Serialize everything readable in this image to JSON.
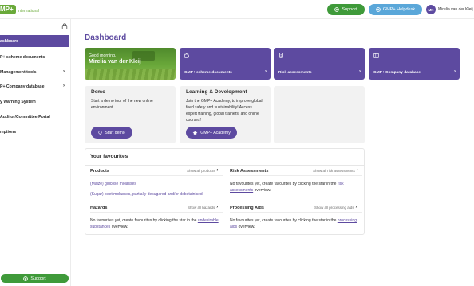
{
  "header": {
    "logo_badge": "MP+",
    "logo_text": "International",
    "support_label": "Support",
    "helpdesk_label": "GMP+ Helpdesk",
    "user_initials": "MK",
    "user_name": "Mirelia van der Kleij"
  },
  "sidebar": {
    "items": [
      {
        "label": "ashboard",
        "active": true,
        "chevron": ""
      },
      {
        "label": "P+ scheme documents",
        "active": false,
        "chevron": ""
      },
      {
        "label": "Management tools",
        "active": false,
        "chevron": "›"
      },
      {
        "label": "P+ Company database",
        "active": false,
        "chevron": "›"
      },
      {
        "label": "y Warning System",
        "active": false,
        "chevron": ""
      },
      {
        "label": "Auditor/Committee Portal",
        "active": false,
        "chevron": ""
      },
      {
        "label": "mptions",
        "active": false,
        "chevron": ""
      }
    ],
    "support_label": "Support"
  },
  "main": {
    "title": "Dashboard",
    "welcome": {
      "greeting": "Good morning,",
      "name": "Mirelia van der Kleij"
    },
    "tiles": [
      {
        "label": "GMP+ scheme documents",
        "icon": "puzzle-icon"
      },
      {
        "label": "Risk assessments",
        "icon": "document-icon"
      },
      {
        "label": "GMP+ Company database",
        "icon": "building-icon"
      }
    ],
    "demo": {
      "title": "Demo",
      "text": "Start a demo tour of the new online environment.",
      "button": "Start demo"
    },
    "learning": {
      "title": "Learning & Development",
      "text": "Join the GMP+ Academy, to improve global feed safety and sustainability! Access expert training, global trainers, and online courses!",
      "button": "GMP+ Academy"
    }
  },
  "favourites": {
    "title": "Your favourites",
    "products": {
      "title": "Products",
      "show_all": "Show all products",
      "items": [
        "(Maize) glucose molasses",
        "(Sugar) beet molasses, partially desugared and/or debetainised"
      ]
    },
    "risk": {
      "title": "Risk Assessments",
      "show_all": "Show all risk assessments",
      "empty_pre": "No favourites yet, create favourites by clicking the star in the",
      "empty_link": "risk assessments",
      "empty_post": "overview."
    },
    "hazards": {
      "title": "Hazards",
      "show_all": "Show all hazards",
      "empty_pre": "No favourites yet, create favourites by clicking the star in the",
      "empty_link": "undesirable substances",
      "empty_post": "overview."
    },
    "aids": {
      "title": "Processing Aids",
      "show_all": "Show all processing aids",
      "empty_pre": "No favourites yet, create favourites by clicking the star in the",
      "empty_link": "processing aids",
      "empty_post": "overview."
    }
  },
  "colors": {
    "brand_green": "#3f9a3a",
    "brand_purple": "#5d4aa0",
    "helpdesk_blue": "#5aa7d9"
  }
}
